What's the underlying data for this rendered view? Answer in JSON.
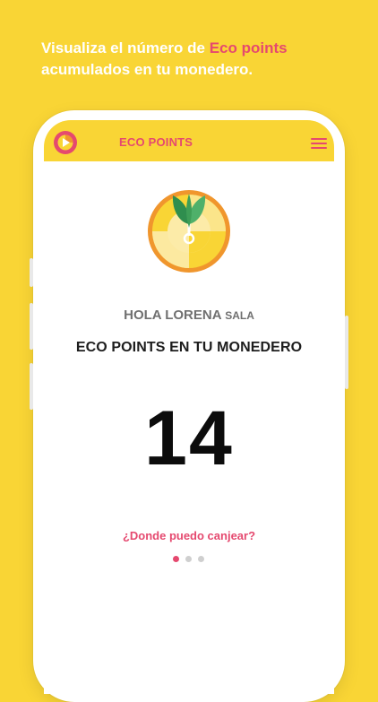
{
  "promo": {
    "line1_prefix": "Visualiza el número de ",
    "line1_highlight": "Eco points",
    "line2": "acumulados en tu monedero."
  },
  "app": {
    "title": "ECO POINTS"
  },
  "greeting": {
    "name": "HOLA LORENA",
    "suffix": "SALA"
  },
  "wallet": {
    "heading": "ECO POINTS EN TU MONEDERO",
    "points": "14"
  },
  "redeem_link": "¿Donde puedo canjear?",
  "pagination": {
    "total": 3,
    "active": 1
  },
  "colors": {
    "background": "#F9D535",
    "accent": "#E5496F",
    "leaf": "#3E9E57",
    "orange": "#F0962D"
  },
  "icons": {
    "logo": "eco-points-logo-icon",
    "menu": "hamburger-menu-icon",
    "badge": "leaf-sprout-coin-icon"
  }
}
